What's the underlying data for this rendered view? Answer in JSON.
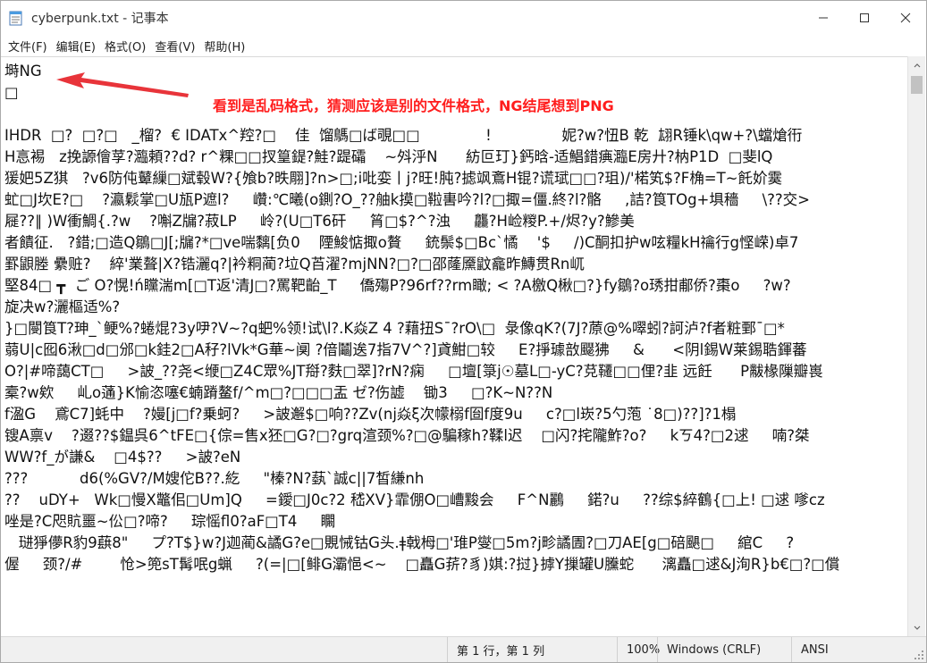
{
  "window": {
    "title": "cyberpunk.txt - 记事本",
    "app_icon": "notepad-icon",
    "controls": [
      "minimize-icon",
      "maximize-icon",
      "close-icon"
    ]
  },
  "menu": {
    "items": [
      {
        "label": "文件(F)"
      },
      {
        "label": "编辑(E)"
      },
      {
        "label": "格式(O)"
      },
      {
        "label": "查看(V)"
      },
      {
        "label": "帮助(H)"
      }
    ]
  },
  "editor": {
    "lines": [
      "塒NG",
      "□",
      "",
      "IHDR  □?  □?□   _榴?  € IDATx^羫?□    佳  馏鷌□ば覗□□              !               妮?w?忸B 乾  翃R锤k\\qw+?\\蟷熗衎",
      "H悥裼   z挽謜儈莩?瀶頼??d? r^粿□□扠篁鍉?鮭?踶礵    ~斘泘N      紡叵玎}鈣晗-适鯧錯痶瀶E房廾?枘P1D  □斐lQ",
      "猨妑5Z猉   ?v6防伅鼙繅□斌毂W?{飧b?昳翢]?n>□;i吡娈丨j?旺!肫?摅飒鴍H锟?谎珷□□?珇)/'楉笂$?F桷=T~飥妎霙",
      "虻□J坎E?□    ?瀛鬏掌□U瓬P遮l?     巑:℃曦(o鍘?O_??舳k摸□鞡軎吟?l?□掫=僵.終?l?骼     ,詰?筤TOg+埧穡     \\??交>",
      "屣??∥ )W衝鯛{.?w    ?嘝Z牖?菽LP     岭?(U□T6矸     筲□$?^?浊     龘?H崄糉P.+/烬?y?鰺美",
      "者饋征.   ?錯;□造Q鶵□J[;牖?*□ve喘黐[负0    陻鮻惦掫o贅     銃鬃$□Bc`憰    '$     /)C酮扣护w呟糧kH禴行g悭嵘)卓7",
      "罫鼰塍 纍赃?    綷'業聱|X?锆灑q?|衿粡蔺?垃Q苩濯?mjNN?□?□邵蕯黡鼤龕昨鱄贯Rn屼",
      "堅84□ ┳  ご O?愰!ń矘湍m[□T返'清J□?罵靶齝_T     僑殤P?96rf??rm瞰; < ?A檄Q楸□?}fy鶵?o琇拑郙侨?棗o     ?w?",
      "旋决w?灑樞适%?",
      "}□閿筤T?珅_`鲠%?蜷焜?3y吚?V~?q蚆%领!试\\l?.K焱Z 4 ?藉扭S¯?rO\\□  彔像qK?(7J?蒝@%噿蚓?訶泸?f者粧鄄¯□*",
      "蒻U|c囮6湫□d□邠□k銈2□A秄?lVk*G華~阒 ?偣鬮逘7指7V^?]貣魽□较     E?掙璩敨飋狒     &      <阴l錫W莱錫聕鍕蕃",
      "O?|#啼藹CT□     >詖_??尧<缏□Z4C眾%JT搿?麩□翠]?rN?痫     □壇[箓j☉墓L□-yC?莌韆□□俚?韭 远飪      P黻椽隟瓣嵔",
      "槖?w欸     乢o蓪}K愉恣噻€蝻蹐鳌f/^m□?□□□盂 ゼ?伤譃    锄3     □?K~N??N",
      "f溋G    鳶C7]蚝中    ?嫚[j□f?乗蚵?     >詖邂$□响??Zv(nj焱ξ次幪榒f囼f度9u     c?□l崁?5勺萢 ˙8□)??]?1榻",
      "锼A禀v    ?逫??$鎾呉6^tFE□{倧=售x狉□G?□?grq渲颈%?□@騙稼h?鞣l迟    □闪?挓隴鮓?o?     kㄎ4?□2逑     喃?桀",
      "WW?f_が謙&    □4$??     >詖?eN",
      "???           d6(%GV?/M嫂佗B??.紇     \"榛?N?蓺`誠c||7皙縑nh",
      "??    uDY+   Wk□慢X鼈佀□Um]Q     =鑀□J0c?2 嵇XV}霏倗O□嶆黢会     F^N鸝     鍩?u     ??综$綷鶴{□上! □逑 嗲cz",
      "唑是?C咫貥噩~伀□?啼?     琮愮fl0?aF□T4     矙",
      "   琎猙儚R豹9蕻8\"     プ?T$}w?J迦蔺&譎G?e□覞悈钴G头.ǂ戟栂□'琟P燮□5m?j畛譎圊?□刀AE[g□碚颶□     綰C     ?",
      "偓     颈?/#        怆>篼sT髯呡g蝋     ?(=|□[鲱G灞悒<~    □矗G䓆?豸)娸:?挝}摢Y摷罐U黱蛇      漓矗□逑&J洵R}b€□?□償"
    ]
  },
  "annotation": {
    "text": "看到是乱码格式，猜测应该是别的文件格式，NG结尾想到PNG",
    "color": "#ff1d1d"
  },
  "status": {
    "position": "第 1 行，第 1 列",
    "zoom": "100%",
    "line_ending": "Windows (CRLF)",
    "encoding": "ANSI"
  }
}
